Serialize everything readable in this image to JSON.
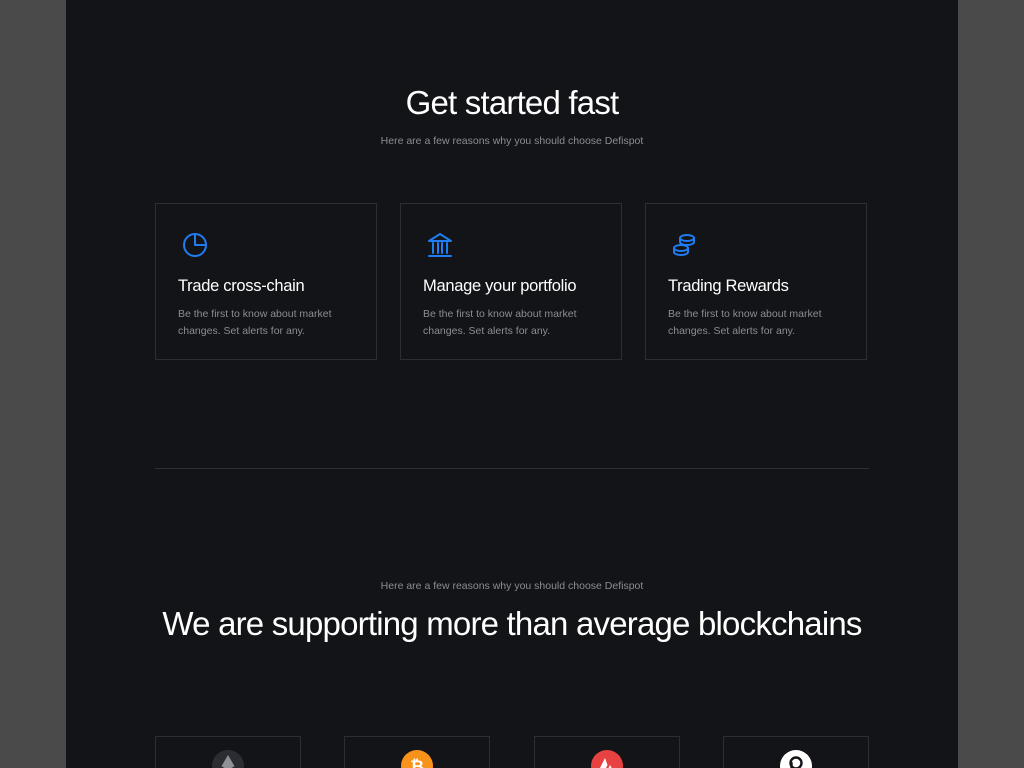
{
  "hero": {
    "title": "Get started fast",
    "subtitle": "Here are a few reasons why you should choose Defispot"
  },
  "features": [
    {
      "icon": "pie-chart-icon",
      "title": "Trade cross-chain",
      "description": "Be the first to know about market changes. Set alerts for any."
    },
    {
      "icon": "bank-icon",
      "title": "Manage your portfolio",
      "description": "Be the first to know about market changes. Set alerts for any."
    },
    {
      "icon": "coins-icon",
      "title": "Trading Rewards",
      "description": "Be the first to know about market changes. Set alerts for any."
    }
  ],
  "blockchains_section": {
    "subtitle": "Here are a few reasons why you should choose Defispot",
    "title": "We are supporting more than average blockchains"
  },
  "chains": [
    {
      "icon": "ethereum-logo-icon",
      "color": "#2b2d33"
    },
    {
      "icon": "bitcoin-logo-icon",
      "color": "#f7931a"
    },
    {
      "icon": "avalanche-logo-icon",
      "color": "#e84142"
    },
    {
      "icon": "polkadot-logo-icon",
      "color": "#ffffff"
    }
  ],
  "colors": {
    "background": "#131417",
    "accent": "#1f7cf2",
    "card_border": "#2c2e33",
    "muted_text": "#8b8d93"
  }
}
